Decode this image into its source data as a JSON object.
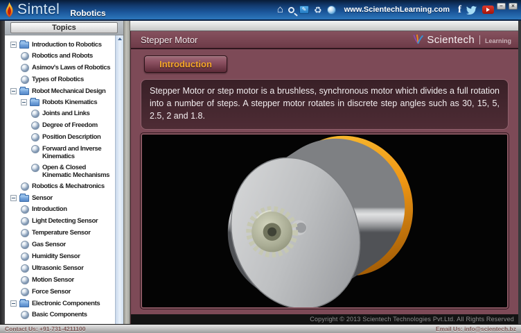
{
  "header": {
    "brand": "Simtel",
    "product": "Robotics",
    "website": "www.ScientechLearning.com",
    "icons": [
      {
        "name": "home-icon"
      },
      {
        "name": "search-icon"
      },
      {
        "name": "screen-edit-icon"
      },
      {
        "name": "refresh-icon"
      },
      {
        "name": "web-globe-icon"
      },
      {
        "name": "facebook-icon"
      },
      {
        "name": "twitter-icon"
      },
      {
        "name": "youtube-icon"
      }
    ],
    "window_controls": [
      {
        "name": "minimize-button",
        "glyph": "–"
      },
      {
        "name": "close-button",
        "glyph": "×"
      }
    ]
  },
  "sidebar": {
    "title": "Topics",
    "tree": [
      {
        "label": "Introduction to Robotics",
        "type": "folder",
        "level": 0
      },
      {
        "label": "Robotics and Robots",
        "type": "leaf",
        "level": 1
      },
      {
        "label": "Asimov's Laws of Robotics",
        "type": "leaf",
        "level": 1
      },
      {
        "label": "Types of Robotics",
        "type": "leaf",
        "level": 1
      },
      {
        "label": "Robot Mechanical Design",
        "type": "folder",
        "level": 0
      },
      {
        "label": "Robots Kinematics",
        "type": "folder",
        "level": 1
      },
      {
        "label": "Joints and Links",
        "type": "leaf",
        "level": 2
      },
      {
        "label": "Degree of Freedom",
        "type": "leaf",
        "level": 2
      },
      {
        "label": "Position Description",
        "type": "leaf",
        "level": 2
      },
      {
        "label": "Forward and Inverse Kinematics",
        "type": "leaf",
        "level": 2
      },
      {
        "label": "Open & Closed Kinematic Mechanisms",
        "type": "leaf",
        "level": 2
      },
      {
        "label": "Robotics & Mechatronics",
        "type": "leaf",
        "level": 1
      },
      {
        "label": "Sensor",
        "type": "folder",
        "level": 0
      },
      {
        "label": "Introduction",
        "type": "leaf",
        "level": 1
      },
      {
        "label": "Light Detecting Sensor",
        "type": "leaf",
        "level": 1
      },
      {
        "label": "Temperature Sensor",
        "type": "leaf",
        "level": 1
      },
      {
        "label": "Gas Sensor",
        "type": "leaf",
        "level": 1
      },
      {
        "label": "Humidity Sensor",
        "type": "leaf",
        "level": 1
      },
      {
        "label": "Ultrasonic Sensor",
        "type": "leaf",
        "level": 1
      },
      {
        "label": "Motion Sensor",
        "type": "leaf",
        "level": 1
      },
      {
        "label": "Force Sensor",
        "type": "leaf",
        "level": 1
      },
      {
        "label": "Electronic Components",
        "type": "folder",
        "level": 0
      },
      {
        "label": "Basic Components",
        "type": "leaf",
        "level": 1
      }
    ]
  },
  "content": {
    "page_title": "Stepper Motor",
    "logo": {
      "name": "Scientech",
      "tagline": "Learning"
    },
    "tab_label": "Introduction",
    "description": "Stepper Motor or step motor is a brushless, synchronous motor which divides a full rotation into a number of steps. A stepper motor rotates in discrete step angles such as 30, 15, 5, 2.5, 2 and 1.8.",
    "media": {
      "subject": "stepper-motor-3d-model"
    },
    "copyright": "Copyright © 2013 Scientech Technologies Pvt.Ltd. All Rights Reserved"
  },
  "footer": {
    "contact": "Contact Us: +91-731-4211100",
    "email": "Email Us: info@scientech.bz"
  },
  "colors": {
    "header_blue": "#1b579b",
    "content_maroon": "#7d4a57",
    "panel_maroon": "#45262e",
    "tab_text_orange": "#f4a62a",
    "motor_rim_orange": "#ef9715",
    "folder_blue": "#5e93d2"
  }
}
